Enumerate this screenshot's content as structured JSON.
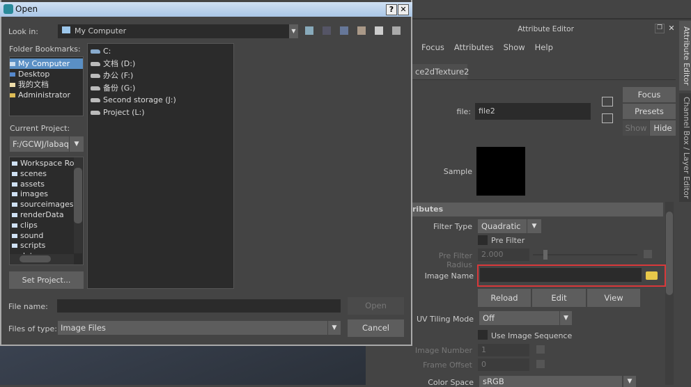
{
  "dialog": {
    "title": "Open",
    "help_label": "?",
    "close_label": "✕",
    "look_in_label": "Look in:",
    "look_in_value": "My Computer",
    "bookmarks_label": "Folder Bookmarks:",
    "bookmarks": [
      {
        "label": "My Computer",
        "selected": true
      },
      {
        "label": "Desktop"
      },
      {
        "label": "我的文档"
      },
      {
        "label": "Administrator"
      }
    ],
    "drives": [
      "C:",
      "文档 (D:)",
      "办公 (F:)",
      "备份 (G:)",
      "Second storage (J:)",
      "Project (L:)"
    ],
    "current_project_label": "Current Project:",
    "current_project_value": "F:/GCWJ/labaqı",
    "project_folders": [
      "Workspace Roo",
      "scenes",
      "assets",
      "images",
      "sourceimages",
      "renderData",
      "clips",
      "sound",
      "scripts",
      "data"
    ],
    "set_project_label": "Set Project...",
    "file_name_label": "File name:",
    "file_name_value": "",
    "files_of_type_label": "Files of type:",
    "files_of_type_value": "Image Files",
    "open_label": "Open",
    "cancel_label": "Cancel"
  },
  "attribute_editor": {
    "header": "Attribute Editor",
    "menu": [
      "Focus",
      "Attributes",
      "Show",
      "Help"
    ],
    "tab": "ce2dTexture2",
    "file_label": "file:",
    "file_value": "file2",
    "focus_label": "Focus",
    "presets_label": "Presets",
    "show_label": "Show",
    "hide_label": "Hide",
    "sample_label": "Sample",
    "section": "ributes",
    "filter_type_label": "Filter Type",
    "filter_type_value": "Quadratic",
    "pre_filter_label": "Pre Filter",
    "pre_filter_radius_label": "Pre Filter Radius",
    "pre_filter_radius_value": "2.000",
    "image_name_label": "Image Name",
    "image_name_value": "",
    "reload_label": "Reload",
    "edit_label": "Edit",
    "view_label": "View",
    "uv_tiling_label": "UV Tiling Mode",
    "uv_tiling_value": "Off",
    "use_sequence_label": "Use Image Sequence",
    "image_number_label": "Image Number",
    "image_number_value": "1",
    "frame_offset_label": "Frame Offset",
    "frame_offset_value": "0",
    "color_space_label": "Color Space",
    "color_space_value": "sRGB",
    "highlight_color": "#d9383a"
  },
  "side_tabs": [
    "Attribute Editor",
    "Channel Box / Layer Editor"
  ]
}
